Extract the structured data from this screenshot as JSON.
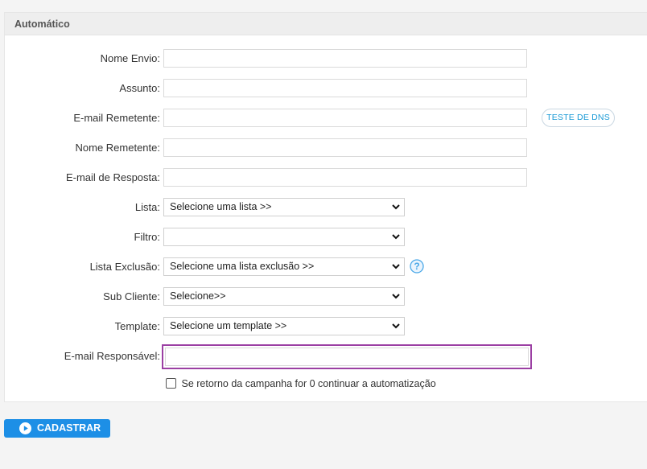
{
  "panel": {
    "title": "Automático"
  },
  "fields": {
    "nome_envio": {
      "label": "Nome Envio:",
      "value": ""
    },
    "assunto": {
      "label": "Assunto:",
      "value": ""
    },
    "email_remetente": {
      "label": "E-mail Remetente:",
      "value": ""
    },
    "nome_remetente": {
      "label": "Nome Remetente:",
      "value": ""
    },
    "email_resposta": {
      "label": "E-mail de Resposta:",
      "value": ""
    },
    "lista": {
      "label": "Lista:",
      "selected": "Selecione uma lista >>"
    },
    "filtro": {
      "label": "Filtro:",
      "selected": ""
    },
    "lista_exclusao": {
      "label": "Lista Exclusão:",
      "selected": "Selecione uma lista exclusão >>"
    },
    "sub_cliente": {
      "label": "Sub Cliente:",
      "selected": "Selecione>>"
    },
    "template": {
      "label": "Template:",
      "selected": "Selecione um template >>"
    },
    "email_responsavel": {
      "label": "E-mail Responsável:",
      "value": ""
    }
  },
  "buttons": {
    "teste_dns": "TESTE DE DNS",
    "cadastrar": "CADASTRAR"
  },
  "checkbox": {
    "label": "Se retorno da campanha for 0 continuar a automatização",
    "checked": false
  },
  "icons": {
    "help": "question-circle-icon",
    "submit": "play-circle-icon",
    "select_arrow": "chevron-down-icon"
  },
  "colors": {
    "accent": "#1d8fe6",
    "focus_border": "#9b3fa3",
    "dns_text": "#1a9ad6",
    "help_icon": "#4aa8e8"
  }
}
